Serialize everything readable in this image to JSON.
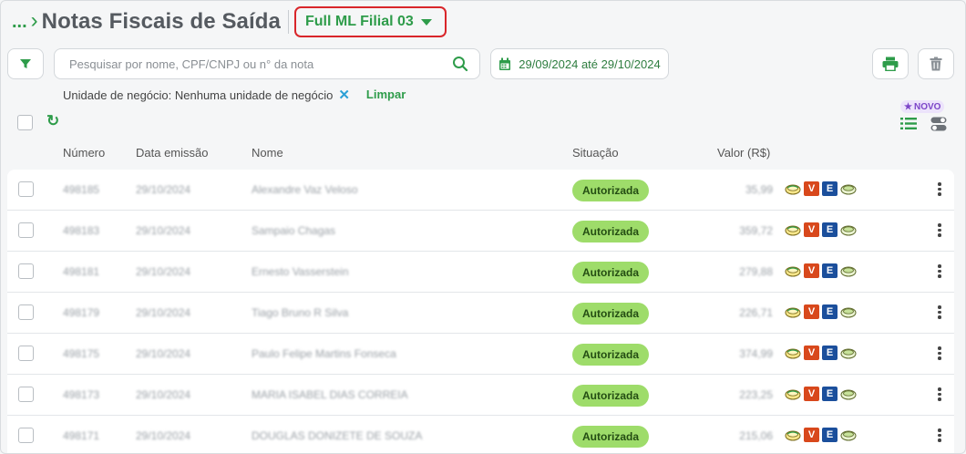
{
  "header": {
    "breadcrumb": "...",
    "title": "Notas Fiscais de Saída",
    "branch": "Full ML Filial 03"
  },
  "toolbar": {
    "search_placeholder": "Pesquisar por nome, CPF/CNPJ ou n° da nota",
    "date_range": "29/09/2024 até 29/10/2024",
    "filter_icon": "filter-icon",
    "print_icon": "printer-icon",
    "trash_icon": "trash-icon"
  },
  "chips": {
    "business_unit": "Unidade de negócio: Nenhuma unidade de negócio",
    "clear": "Limpar"
  },
  "view": {
    "novo_badge": "NOVO"
  },
  "table": {
    "headers": {
      "number": "Número",
      "date": "Data emissão",
      "name": "Nome",
      "status": "Situação",
      "value": "Valor (R$)"
    },
    "rows": [
      {
        "number": "498185",
        "date": "29/10/2024",
        "name": "Alexandre Vaz Veloso",
        "status": "Autorizada",
        "value": "35,99"
      },
      {
        "number": "498183",
        "date": "29/10/2024",
        "name": "Sampaio Chagas",
        "status": "Autorizada",
        "value": "359,72"
      },
      {
        "number": "498181",
        "date": "29/10/2024",
        "name": "Ernesto Vasserstein",
        "status": "Autorizada",
        "value": "279,88"
      },
      {
        "number": "498179",
        "date": "29/10/2024",
        "name": "Tiago Bruno R Silva",
        "status": "Autorizada",
        "value": "226,71"
      },
      {
        "number": "498175",
        "date": "29/10/2024",
        "name": "Paulo Felipe Martins Fonseca",
        "status": "Autorizada",
        "value": "374,99"
      },
      {
        "number": "498173",
        "date": "29/10/2024",
        "name": "MARIA ISABEL DIAS CORREIA",
        "status": "Autorizada",
        "value": "223,25"
      },
      {
        "number": "498171",
        "date": "29/10/2024",
        "name": "DOUGLAS DONIZETE DE SOUZA",
        "status": "Autorizada",
        "value": "215,06"
      }
    ],
    "row_icons": {
      "v": "V",
      "e": "E"
    }
  },
  "colors": {
    "accent_green": "#2e9c4a",
    "badge_green": "#9edc6a",
    "highlight_red": "#d9262a"
  }
}
